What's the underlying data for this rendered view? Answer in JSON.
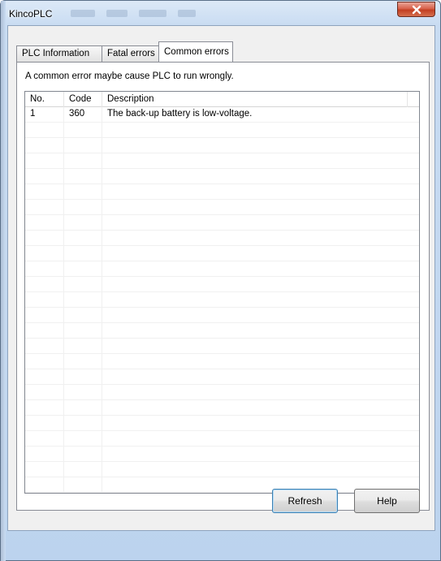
{
  "window": {
    "title": "KincoPLC",
    "close_symbol": "X"
  },
  "tabs": [
    {
      "label": "PLC Information",
      "active": false
    },
    {
      "label": "Fatal errors",
      "active": false
    },
    {
      "label": "Common errors",
      "active": true
    }
  ],
  "panel": {
    "description": "A common error maybe cause PLC to run wrongly."
  },
  "table": {
    "columns": [
      "No.",
      "Code",
      "Description"
    ],
    "rows": [
      [
        "1",
        "360",
        "The back-up battery is low-voltage."
      ]
    ]
  },
  "buttons": {
    "refresh": "Refresh",
    "help": "Help"
  }
}
